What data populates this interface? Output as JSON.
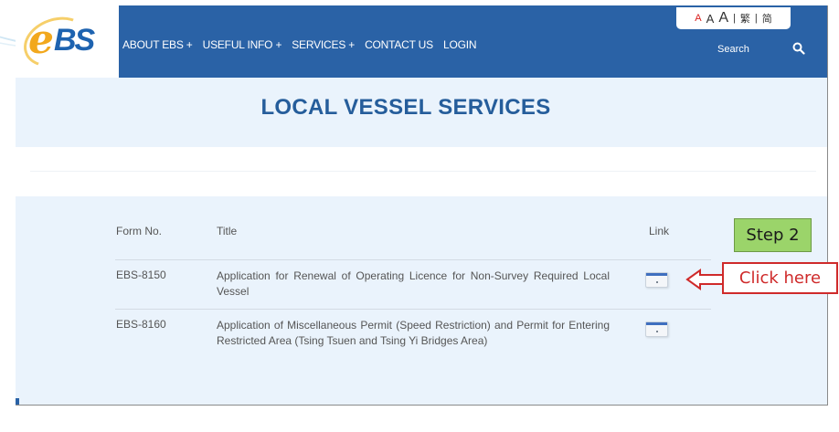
{
  "header": {
    "logo_label": "eBS",
    "nav": [
      "ABOUT EBS +",
      "USEFUL INFO +",
      "SERVICES +",
      "CONTACT US",
      "LOGIN"
    ],
    "font_size": {
      "small": "A",
      "medium": "A",
      "large": "A",
      "sep": "|",
      "traditional": "繁",
      "simplified": "简"
    },
    "search": {
      "placeholder": "Search",
      "icon": "search-icon"
    }
  },
  "page": {
    "title": "LOCAL VESSEL SERVICES"
  },
  "forms_table": {
    "columns": [
      "Form No.",
      "Title",
      "Link"
    ],
    "rows": [
      {
        "form_no": "EBS-8150",
        "title": "Application for Renewal of Operating Licence for Non-Survey Required Local Vessel",
        "link_icon": "form-link-icon"
      },
      {
        "form_no": "EBS-8160",
        "title": "Application of Miscellaneous Permit (Speed Restriction) and Permit for Entering Restricted Area (Tsing Tsuen and Tsing Yi Bridges Area)",
        "link_icon": "form-link-icon"
      }
    ]
  },
  "annotations": {
    "step": "Step 2",
    "click_here": "Click here"
  },
  "colors": {
    "header_blue": "#2a62a6",
    "band_light": "#eaf3fc",
    "title_blue": "#255d9b",
    "accent_red": "#cf2a2a",
    "step_green": "#9bd46a"
  }
}
